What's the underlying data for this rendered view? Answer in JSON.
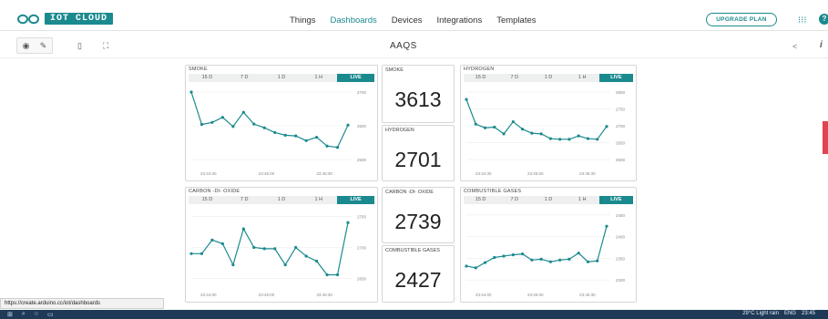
{
  "app": {
    "logo_text": "IOT CLOUD",
    "nav": [
      "Things",
      "Dashboards",
      "Devices",
      "Integrations",
      "Templates"
    ],
    "active_nav": "Dashboards",
    "upgrade_label": "UPGRADE PLAN",
    "dashboard_title": "AAQS",
    "accent_color": "#1b8a8f"
  },
  "ranges": [
    "15 D",
    "7 D",
    "1 D",
    "1 H",
    "LIVE"
  ],
  "charts": [
    {
      "id": "smoke",
      "title": "SMOKE",
      "ticks": [
        "2700",
        "2600",
        "2500"
      ],
      "xticks": [
        "23:44:30",
        "23:45:00",
        "23:45:30"
      ],
      "chart_data": {
        "type": "line",
        "y": [
          2700,
          2604,
          2610,
          2625,
          2598,
          2640,
          2605,
          2594,
          2580,
          2572,
          2570,
          2556,
          2566,
          2540,
          2536,
          2602
        ]
      }
    },
    {
      "id": "hydrogen",
      "title": "HYDROGEN",
      "ticks": [
        "2800",
        "2750",
        "2700",
        "2650",
        "2600"
      ],
      "xticks": [
        "23:44:30",
        "23:45:00",
        "23:45:30"
      ],
      "chart_data": {
        "type": "line",
        "y": [
          2778,
          2705,
          2694,
          2696,
          2676,
          2712,
          2690,
          2678,
          2676,
          2662,
          2660,
          2660,
          2670,
          2662,
          2660,
          2698
        ]
      }
    },
    {
      "id": "co2",
      "title": "CARBON -DI- OXIDE",
      "ticks": [
        "2750",
        "2700",
        "2650"
      ],
      "xticks": [
        "23:44:00",
        "23:45:00",
        "23:45:30"
      ],
      "chart_data": {
        "type": "line",
        "y": [
          2690,
          2690,
          2712,
          2706,
          2672,
          2730,
          2700,
          2698,
          2698,
          2672,
          2700,
          2686,
          2678,
          2656,
          2656,
          2740
        ]
      }
    },
    {
      "id": "combustible",
      "title": "COMBUSTIBLE GASES",
      "ticks": [
        "2450",
        "2400",
        "2350",
        "2300"
      ],
      "xticks": [
        "23:44:00",
        "23:45:00",
        "23:45:30"
      ],
      "chart_data": {
        "type": "line",
        "y": [
          2332,
          2328,
          2340,
          2352,
          2355,
          2358,
          2360,
          2346,
          2348,
          2342,
          2346,
          2348,
          2362,
          2342,
          2344,
          2424
        ]
      }
    }
  ],
  "values": [
    {
      "title": "SMOKE",
      "value": "3613"
    },
    {
      "title": "HYDROGEN",
      "value": "2701"
    },
    {
      "title": "CARBON -DI- OXIDE",
      "value": "2739"
    },
    {
      "title": "COMBUSTIBLE GASES",
      "value": "2427"
    }
  ],
  "status_url": "https://create.arduino.cc/iot/dashboards",
  "taskbar": {
    "weather": "29°C  Light rain",
    "lang": "ENG",
    "time": "23:45"
  }
}
